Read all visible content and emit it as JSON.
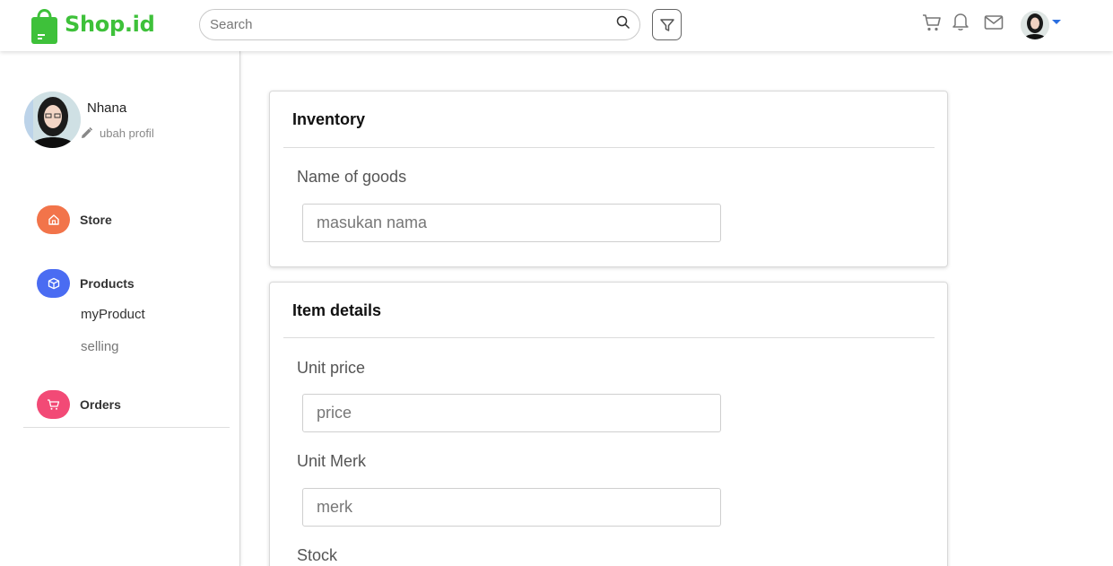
{
  "brand": {
    "name": "Shop.id",
    "color": "#3ec13a"
  },
  "search": {
    "placeholder": "Search"
  },
  "header_icons": [
    "search-icon",
    "filter-icon",
    "cart-icon",
    "bell-icon",
    "mail-icon",
    "avatar",
    "chevron-down-icon"
  ],
  "profile": {
    "name": "Nhana",
    "edit_label": "ubah profil"
  },
  "sidebar": {
    "store": {
      "label": "Store",
      "color": "#f2744a"
    },
    "products": {
      "label": "Products",
      "color": "#4a6cf2",
      "items": [
        "myProduct",
        "selling"
      ]
    },
    "orders": {
      "label": "Orders",
      "color": "#f24a76"
    }
  },
  "inventory": {
    "title": "Inventory",
    "name_label": "Name of goods",
    "name_placeholder": "masukan nama"
  },
  "item_details": {
    "title": "Item details",
    "price_label": "Unit price",
    "price_placeholder": "price",
    "merk_label": "Unit Merk",
    "merk_placeholder": "merk",
    "stock_label": "Stock"
  }
}
